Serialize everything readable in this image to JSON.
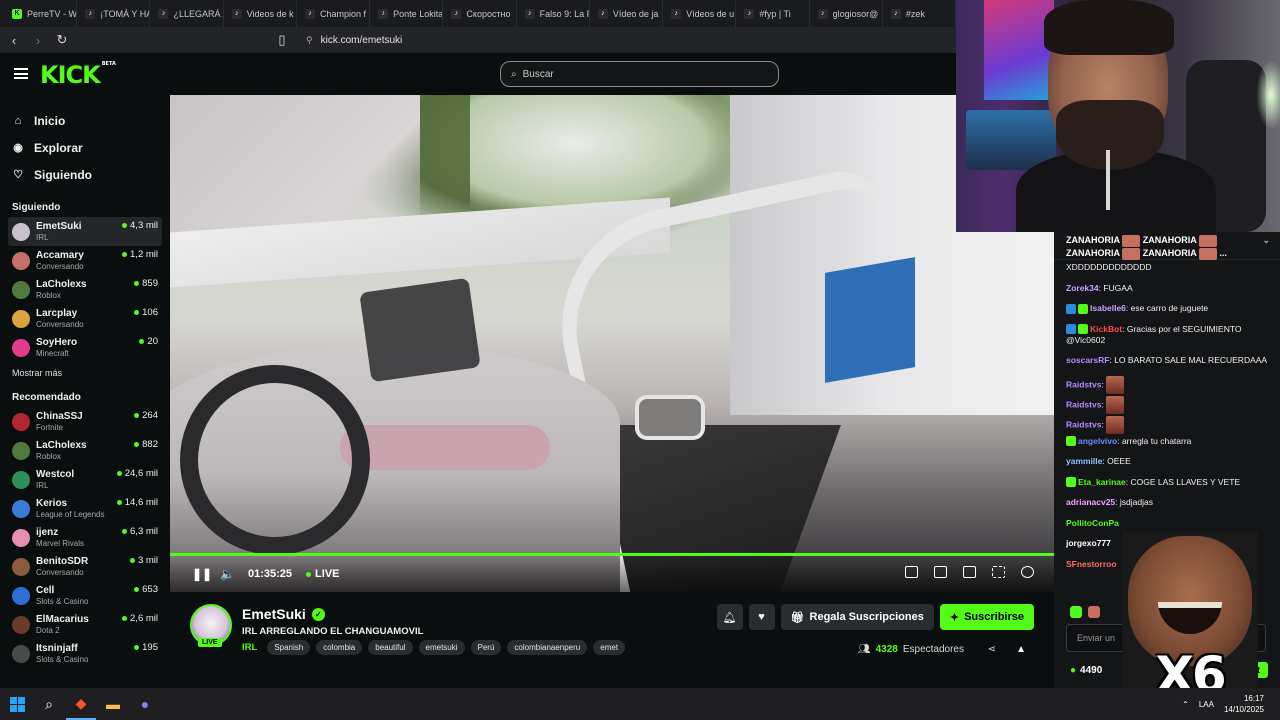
{
  "browser": {
    "tabs": [
      {
        "label": "PerreTV - W",
        "icon": "kick-icon"
      },
      {
        "label": "¡TOMÁ Y HA",
        "icon": "tiktok-icon"
      },
      {
        "label": "¿LLEGARÁ A",
        "icon": "tiktok-icon"
      },
      {
        "label": "Videos de k",
        "icon": "tiktok-icon"
      },
      {
        "label": "Champion f",
        "icon": "tiktok-icon"
      },
      {
        "label": "Ponte Lokita",
        "icon": "tiktok-icon"
      },
      {
        "label": "Скоростно",
        "icon": "tiktok-icon"
      },
      {
        "label": "Falso 9: La F",
        "icon": "tiktok-icon"
      },
      {
        "label": "Vídeo de ja",
        "icon": "tiktok-icon"
      },
      {
        "label": "Vídeos de u",
        "icon": "tiktok-icon"
      },
      {
        "label": "#fyp | Ti",
        "icon": "tiktok-icon"
      },
      {
        "label": "glogiosor@",
        "icon": "tiktok-icon"
      },
      {
        "label": "#zek",
        "icon": "tiktok-icon"
      }
    ],
    "url": "kick.com/emetsuki"
  },
  "header": {
    "logo": "KICK",
    "logo_badge": "BETA",
    "search_placeholder": "Buscar"
  },
  "sidebar": {
    "nav": [
      {
        "label": "Inicio",
        "icon": "home-icon"
      },
      {
        "label": "Explorar",
        "icon": "compass-icon"
      },
      {
        "label": "Siguiendo",
        "icon": "heart-icon"
      }
    ],
    "following_title": "Siguiendo",
    "following": [
      {
        "name": "EmetSuki",
        "category": "IRL",
        "viewers": "4,3 mil",
        "color": "#c9c0cc",
        "active": true
      },
      {
        "name": "Accamary",
        "category": "Conversando",
        "viewers": "1,2 mil",
        "color": "#c46f6a"
      },
      {
        "name": "LaCholexs",
        "category": "Roblox",
        "viewers": "859",
        "color": "#4f7a3d"
      },
      {
        "name": "Larcplay",
        "category": "Conversando",
        "viewers": "106",
        "color": "#d9a441"
      },
      {
        "name": "SoyHero",
        "category": "Minecraft",
        "viewers": "20",
        "color": "#e03c8a"
      }
    ],
    "show_more": "Mostrar más",
    "recommended_title": "Recomendado",
    "recommended": [
      {
        "name": "ChinaSSJ",
        "category": "Fortnite",
        "viewers": "264",
        "color": "#b3262f"
      },
      {
        "name": "LaCholexs",
        "category": "Roblox",
        "viewers": "882",
        "color": "#4f7a3d"
      },
      {
        "name": "Westcol",
        "category": "IRL",
        "viewers": "24,6 mil",
        "color": "#2f8f5a"
      },
      {
        "name": "Kerios",
        "category": "League of Legends",
        "viewers": "14,6 mil",
        "color": "#3a7bd5"
      },
      {
        "name": "ijenz",
        "category": "Marvel Rivals",
        "viewers": "6,3 mil",
        "color": "#e58fb2"
      },
      {
        "name": "BenitoSDR",
        "category": "Conversando",
        "viewers": "3 mil",
        "color": "#8a5a3c"
      },
      {
        "name": "Cell",
        "category": "Slots & Casino",
        "viewers": "653",
        "color": "#2d6fd6"
      },
      {
        "name": "ElMacarius",
        "category": "Dota 2",
        "viewers": "2,6 mil",
        "color": "#6a3b2a"
      },
      {
        "name": "Itsninjaff",
        "category": "Slots & Casino",
        "viewers": "195",
        "color": "#4a4a4a"
      }
    ]
  },
  "player": {
    "time": "01:35:25",
    "live": "LIVE",
    "progress": 1.0
  },
  "stream": {
    "streamer": "EmetSuki",
    "live_badge": "LIVE",
    "title": "IRL ARREGLANDO EL CHANGUAMOVIL",
    "category": "IRL",
    "tags": [
      "Spanish",
      "colombia",
      "beautiful",
      "emetsuki",
      "Perú",
      "colombianaenperu",
      "emet"
    ],
    "gift_label": "Regala Suscripciones",
    "subscribe_label": "Suscribirse",
    "viewers": "4328",
    "viewers_label": "Espectadores"
  },
  "chat": {
    "pinned_line1": "ZANAHORIA",
    "pinned_line1b": "ZANAHORIA",
    "pinned_line2": "ZANAHORIA",
    "pinned_line2b": "ZANAHORIA",
    "pinned_more": "...",
    "messages": [
      {
        "user": "",
        "text": "XDDDDDDDDDDDDD",
        "color": "#ffffff"
      },
      {
        "user": "Zorek34",
        "text": "FUGAA",
        "color": "#c9a3ff"
      },
      {
        "user": "Isabelle6",
        "text": "ese carro de juguete",
        "color": "#c9a3ff",
        "badges": [
          "#2a8ce0",
          "#53fc18"
        ]
      },
      {
        "user": "KickBot",
        "text": "Gracias por el SEGUIMIENTO @Vic0602",
        "color": "#ff4a4a",
        "badges": [
          "#2a8ce0",
          "#53fc18"
        ]
      },
      {
        "user": "soscarsRF",
        "text": "LO BARATO SALE MAL RECUERDAAA",
        "color": "#b98aff"
      },
      {
        "user": "Raidstvs",
        "text": "",
        "color": "#b98aff",
        "emote": true
      },
      {
        "user": "Raidstvs",
        "text": "",
        "color": "#b98aff",
        "emote": true
      },
      {
        "user": "Raidstvs",
        "text": "",
        "color": "#b98aff",
        "emote": true
      },
      {
        "user": "angelvivo",
        "text": "arregla tu chatarra",
        "color": "#6b8cff",
        "badges": [
          "#53fc18"
        ]
      },
      {
        "user": "yammille",
        "text": "OEEE",
        "color": "#8fc3ff"
      },
      {
        "user": "Eta_karinae",
        "text": "COGE LAS LLAVES Y VETE",
        "color": "#53fc18",
        "badges": [
          "#53fc18"
        ]
      },
      {
        "user": "adrianacv25",
        "text": "jsdjadjas",
        "color": "#f0a6ff"
      },
      {
        "user": "PollitoConPa",
        "text": "",
        "color": "#53fc18"
      },
      {
        "user": "jorgexo777",
        "text": "",
        "color": "#ffffff"
      },
      {
        "user": "SFnestorroo",
        "text": "",
        "color": "#ff6a6a"
      }
    ],
    "input_placeholder": "Enviar un",
    "points": "4490",
    "send_label": "Chat"
  },
  "overlay": {
    "text": "X6"
  },
  "taskbar": {
    "lang": "LAA",
    "time": "16:17",
    "date": "14/10/2025"
  }
}
